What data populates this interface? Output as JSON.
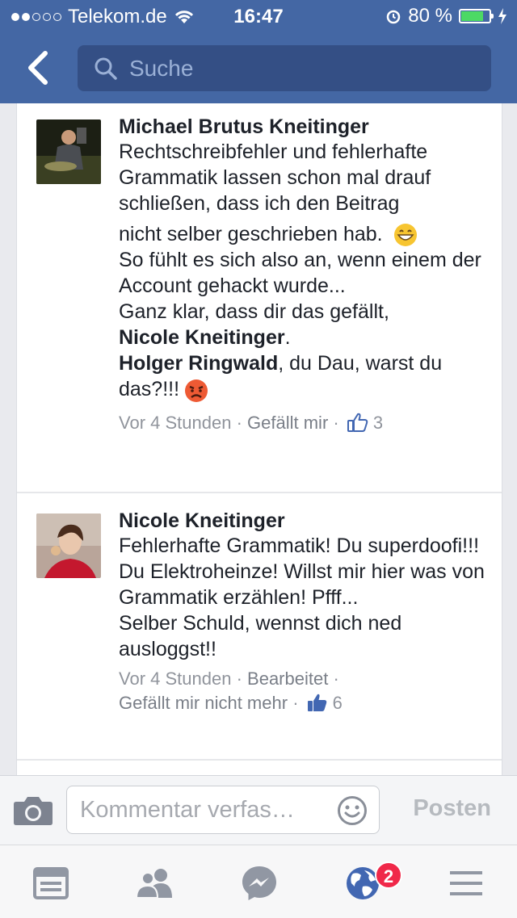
{
  "status_bar": {
    "carrier": "Telekom.de",
    "time": "16:47",
    "battery": "80 %",
    "battery_level": 0.8
  },
  "nav": {
    "search_placeholder": "Suche"
  },
  "comments": [
    {
      "author": "Michael Brutus Kneitinger",
      "text_1": "Rechtschreibfehler und fehlerhafte Grammatik lassen schon mal drauf schließen, dass ich den Beitrag",
      "text_2": "nicht selber geschrieben hab.",
      "text_3": "So fühlt es sich also an, wenn einem der Account gehackt wurde...",
      "text_4": "Ganz klar, dass dir das gefällt,",
      "mention_1": "Nicole Kneitinger",
      "text_5": ".",
      "mention_2": "Holger Ringwald",
      "text_6": ", du Dau, warst du das?!!!",
      "time": "Vor 4 Stunden",
      "sep": "·",
      "action": "Gefällt mir",
      "likes": "3"
    },
    {
      "author": "Nicole Kneitinger",
      "text": "Fehlerhafte Grammatik! Du superdoofi!!! Du Elektroheinze! Willst mir hier was von Grammatik erzählen! Pfff...\nSelber Schuld, wennst dich ned ausloggst!!",
      "time": "Vor 4 Stunden",
      "sep": "·",
      "edited": "Bearbeitet",
      "action": "Gefällt mir nicht mehr",
      "likes": "6"
    }
  ],
  "composer": {
    "placeholder": "Kommentar verfas…",
    "post_label": "Posten"
  },
  "tabbar": {
    "badge": "2"
  },
  "colors": {
    "brand": "#4467a4",
    "text": "#1d2129",
    "meta": "#90949c",
    "like_blue": "#4267b2",
    "badge": "#f02849"
  },
  "icons": [
    "back-chevron-icon",
    "search-icon",
    "grin-emoji-icon",
    "angry-emoji-icon",
    "like-icon",
    "camera-icon",
    "smiley-icon",
    "news-feed-icon",
    "friends-icon",
    "messenger-icon",
    "globe-icon",
    "menu-icon"
  ]
}
